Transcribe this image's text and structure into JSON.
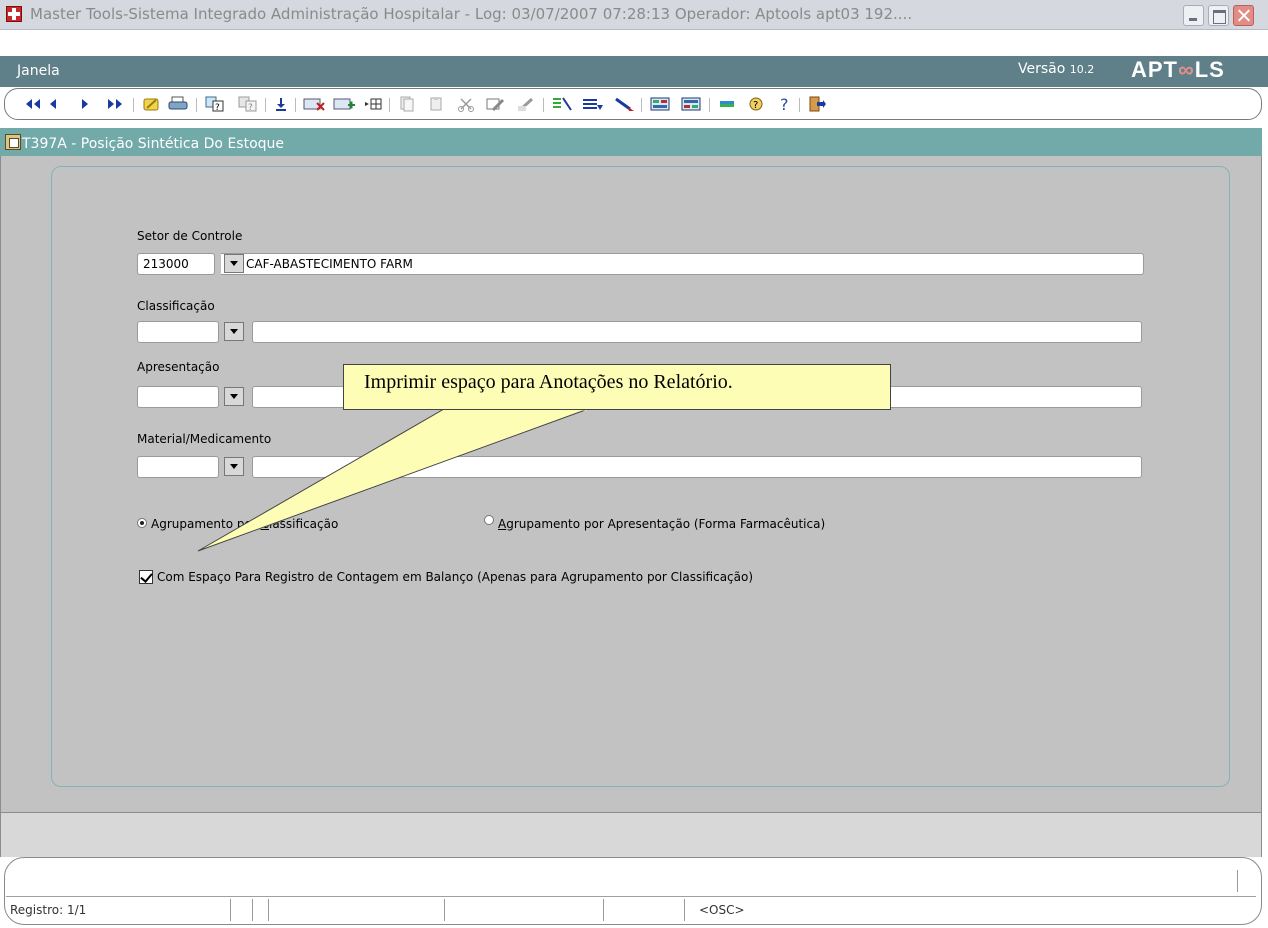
{
  "window": {
    "title": "Master Tools-Sistema Integrado Administração Hospitalar - Log: 03/07/2007 07:28:13 Operador: Aptools apt03 192...."
  },
  "menubar": {
    "janela_first": "J",
    "janela_rest": "anela",
    "versao_label": "Versão ",
    "versao_number": "10.2",
    "logo_left": "APT",
    "logo_mid": "∞",
    "logo_right": "LS"
  },
  "toolbar": {
    "icons": [
      "first-record-icon",
      "previous-record-icon",
      "next-record-icon",
      "last-record-icon",
      "edit-icon",
      "print-icon",
      "query-icon",
      "query-all-icon",
      "save-icon",
      "delete-record-icon",
      "insert-record-icon",
      "duplicate-record-icon",
      "copy-icon",
      "paste-icon",
      "cut-icon",
      "clear-icon",
      "clear-field-icon",
      "list-values-icon",
      "block-icon",
      "edit-field-icon",
      "calc-icon",
      "calendar-icon",
      "screen-icon",
      "help-icon",
      "question-icon",
      "exit-icon"
    ]
  },
  "form": {
    "title": "T397A - Posição Sintética Do Estoque",
    "setor": {
      "label": "Setor de Controle",
      "code": "213000",
      "description": "CAF-ABASTECIMENTO FARM"
    },
    "classificacao": {
      "label": "Classificação",
      "code": "",
      "description": ""
    },
    "apresentacao": {
      "label": "Apresentação",
      "code": "",
      "description": ""
    },
    "material": {
      "label": "Material/Medicamento",
      "code": "",
      "description": ""
    },
    "radio1": {
      "prefix": "Agrupamento por ",
      "accel": "C",
      "suffix": "lassificação",
      "selected": true
    },
    "radio2": {
      "accel": "A",
      "suffix": "grupamento por Apresentação (Forma Farmacêutica)",
      "selected": false
    },
    "checkbox": {
      "label": "Com Espaço Para Registro de Contagem em Balanço (Apenas para Agrupamento por Classificação)",
      "checked": true
    }
  },
  "tooltip": {
    "text": "Imprimir espaço para Anotações no Relatório."
  },
  "statusbar": {
    "registro": "Registro: 1/1",
    "mode": "<OSC>"
  },
  "colors": {
    "menubar": "#5f7f89",
    "form_header": "#72a9a9",
    "form_body": "#c2c2c2",
    "tooltip_bg": "#fdfdb6"
  }
}
